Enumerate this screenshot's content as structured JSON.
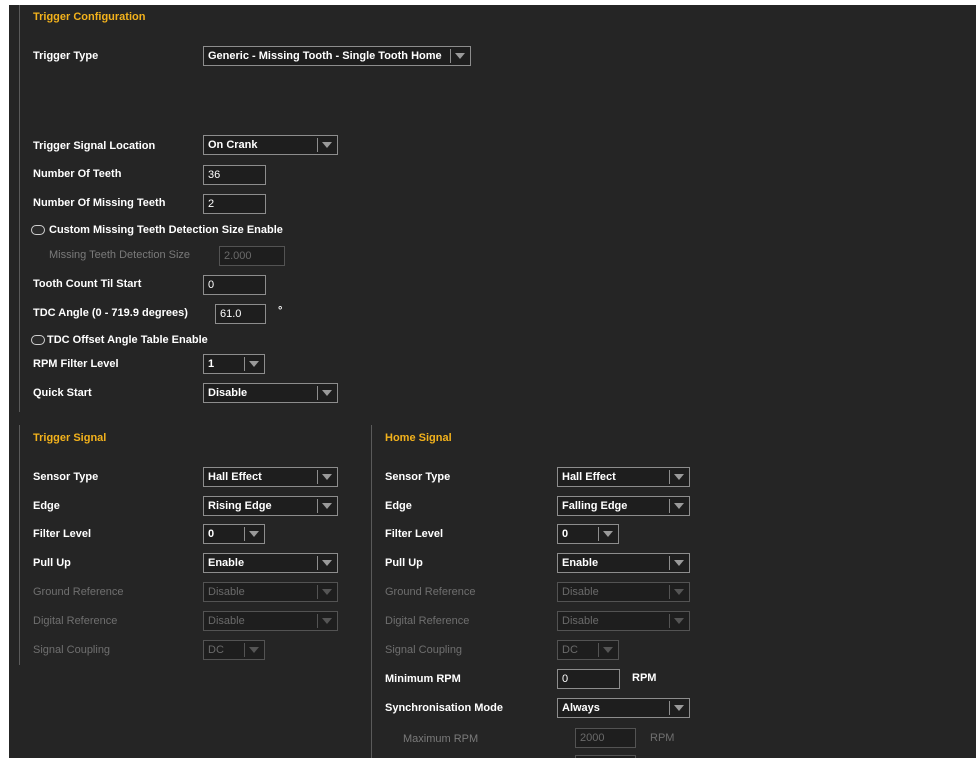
{
  "trigger_config": {
    "title": "Trigger Configuration",
    "trigger_type": {
      "label": "Trigger Type",
      "value": "Generic - Missing Tooth - Single Tooth Home"
    },
    "signal_location": {
      "label": "Trigger Signal Location",
      "value": "On Crank"
    },
    "num_teeth": {
      "label": "Number Of Teeth",
      "value": "36"
    },
    "missing_teeth": {
      "label": "Number Of Missing Teeth",
      "value": "2"
    },
    "custom_missing": {
      "label": "Custom Missing Teeth Detection Size Enable"
    },
    "missing_detect_size": {
      "label": "Missing Teeth Detection Size",
      "value": "2.000"
    },
    "tooth_count_start": {
      "label": "Tooth Count Til Start",
      "value": "0"
    },
    "tdc_angle": {
      "label": "TDC Angle (0 - 719.9 degrees)",
      "value": "61.0",
      "unit": "°"
    },
    "tdc_offset_table": {
      "label": "TDC Offset Angle Table Enable"
    },
    "rpm_filter": {
      "label": "RPM Filter Level",
      "value": "1"
    },
    "quick_start": {
      "label": "Quick Start",
      "value": "Disable"
    }
  },
  "trigger_signal": {
    "title": "Trigger Signal",
    "sensor_type": {
      "label": "Sensor Type",
      "value": "Hall Effect"
    },
    "edge": {
      "label": "Edge",
      "value": "Rising Edge"
    },
    "filter_level": {
      "label": "Filter Level",
      "value": "0"
    },
    "pull_up": {
      "label": "Pull Up",
      "value": "Enable"
    },
    "ground_ref": {
      "label": "Ground Reference",
      "value": "Disable"
    },
    "digital_ref": {
      "label": "Digital Reference",
      "value": "Disable"
    },
    "coupling": {
      "label": "Signal Coupling",
      "value": "DC"
    }
  },
  "home_signal": {
    "title": "Home Signal",
    "sensor_type": {
      "label": "Sensor Type",
      "value": "Hall Effect"
    },
    "edge": {
      "label": "Edge",
      "value": "Falling Edge"
    },
    "filter_level": {
      "label": "Filter Level",
      "value": "0"
    },
    "pull_up": {
      "label": "Pull Up",
      "value": "Enable"
    },
    "ground_ref": {
      "label": "Ground Reference",
      "value": "Disable"
    },
    "digital_ref": {
      "label": "Digital Reference",
      "value": "Disable"
    },
    "coupling": {
      "label": "Signal Coupling",
      "value": "DC"
    },
    "min_rpm": {
      "label": "Minimum RPM",
      "value": "0",
      "unit": "RPM"
    },
    "sync_mode": {
      "label": "Synchronisation Mode",
      "value": "Always"
    },
    "max_rpm": {
      "label": "Maximum RPM",
      "value": "2000",
      "unit": "RPM"
    }
  },
  "colors": {
    "background": "#252525",
    "accent": "#f3b21c",
    "border": "#8d8d8d",
    "disabled_text": "#6f6f6f"
  }
}
